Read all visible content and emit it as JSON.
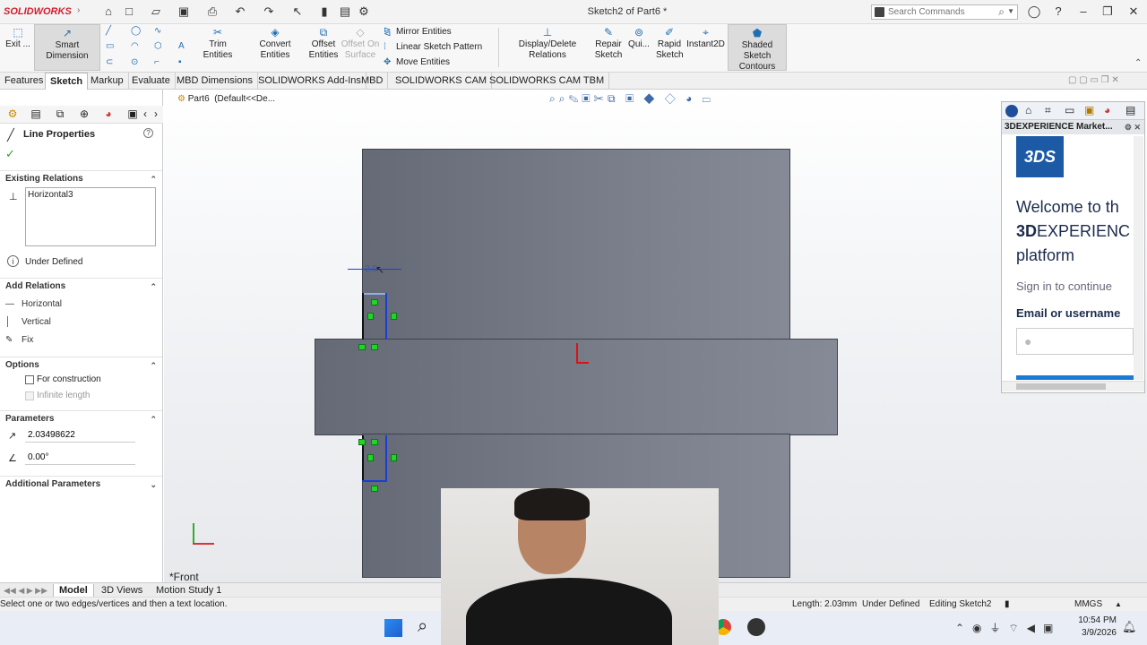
{
  "app": {
    "logo": "SOLIDWORKS",
    "document_title": "Sketch2 of Part6 *"
  },
  "search": {
    "placeholder": "Search Commands"
  },
  "ribbon": {
    "exit_label": "Exit ...",
    "smart_dimension": "Smart Dimension",
    "trim_entities": "Trim Entities",
    "convert_entities": "Convert Entities",
    "offset_entities_1": "Offset",
    "offset_entities_2": "Entities",
    "offset_on_surface_1": "Offset On",
    "offset_on_surface_2": "Surface",
    "mirror_entities": "Mirror Entities",
    "linear_sketch_pattern": "Linear Sketch Pattern",
    "move_entities": "Move Entities",
    "display_delete_relations": "Display/Delete Relations",
    "repair_sketch_1": "Repair",
    "repair_sketch_2": "Sketch",
    "quick_snaps": "Qui...",
    "rapid_sketch_1": "Rapid",
    "rapid_sketch_2": "Sketch",
    "instant2d": "Instant2D",
    "shaded_contours_1": "Shaded Sketch",
    "shaded_contours_2": "Contours"
  },
  "tabs": [
    "Features",
    "Sketch",
    "Markup",
    "Evaluate",
    "MBD Dimensions",
    "SOLIDWORKS Add-Ins",
    "MBD",
    "SOLIDWORKS CAM",
    "SOLIDWORKS CAM TBM"
  ],
  "property_manager": {
    "title": "Line Properties",
    "existing_relations_header": "Existing Relations",
    "existing_relations": [
      "Horizontal3"
    ],
    "status": "Under Defined",
    "add_relations_header": "Add Relations",
    "add_relations": [
      "Horizontal",
      "Vertical",
      "Fix"
    ],
    "options_header": "Options",
    "for_construction": "For construction",
    "infinite_length": "Infinite length",
    "parameters_header": "Parameters",
    "length_value": "2.03498622",
    "angle_value": "0.00°",
    "additional_header": "Additional Parameters"
  },
  "viewport": {
    "breadcrumb_part": "Part6",
    "breadcrumb_config": "(Default<<De...",
    "view_name": "*Front",
    "dim_text": "2.0"
  },
  "marketplace": {
    "title": "3DEXPERIENCE Market...",
    "welcome": "Welcome to th",
    "brand_bold": "3D",
    "brand_rest": "EXPERIENC",
    "platform": "platform",
    "sign_in": "Sign in to continue",
    "email_label": "Email or username"
  },
  "bottom_tabs": [
    "Model",
    "3D Views",
    "Motion Study 1"
  ],
  "status": {
    "hint": "Select one or two edges/vertices and then a text location.",
    "length": "Length: 2.03mm",
    "defined": "Under Defined",
    "editing": "Editing Sketch2",
    "units": "MMGS"
  },
  "taskbar": {
    "time": "10:54 PM",
    "date": "3/9/2026"
  },
  "colors": {
    "accent": "#1f6fb5",
    "sketch_blue": "#1a3fd4",
    "relation_green": "#23d32b",
    "logo_red": "#d0202e"
  }
}
